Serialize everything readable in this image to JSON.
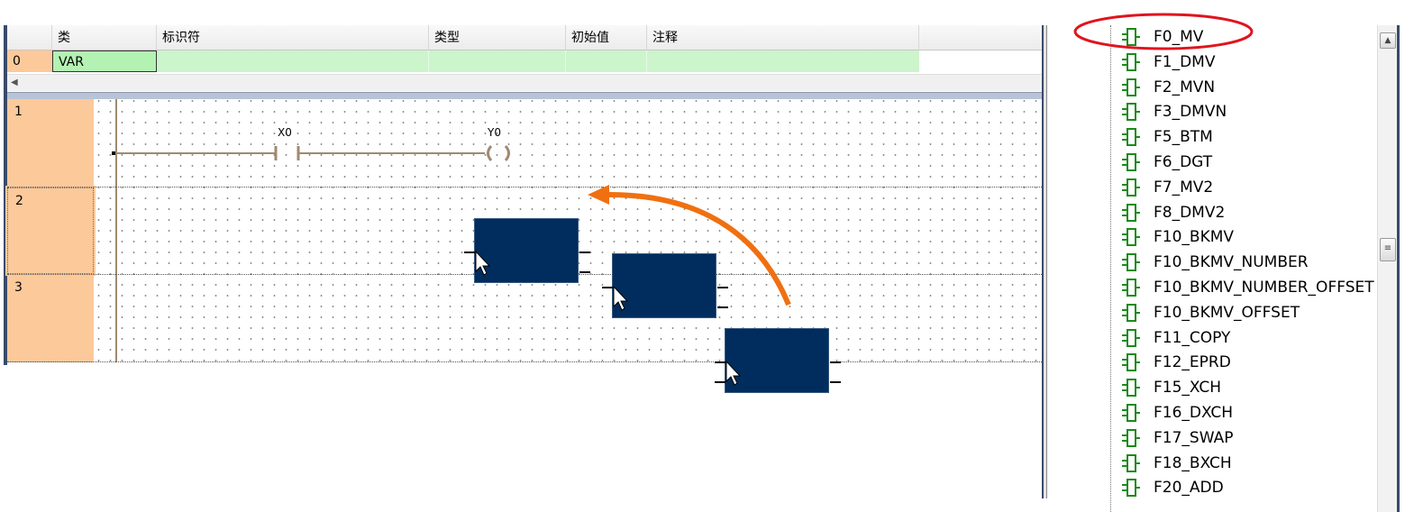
{
  "var_table": {
    "headers": [
      "类",
      "标识符",
      "类型",
      "初始值",
      "注释"
    ],
    "row": {
      "index": "0",
      "class": "VAR"
    },
    "colors": {
      "row_bg": "#ccf5cc",
      "selected_cell": "#b3f2b3"
    }
  },
  "ladder": {
    "rungs": [
      "1",
      "2",
      "3"
    ],
    "contact_label": "X0",
    "coil_label": "Y0",
    "colors": {
      "rung_label_bg": "#fcc99a",
      "wire": "#a08a70",
      "block": "#002d5e"
    }
  },
  "annotations": {
    "arrow_color": "#f07010",
    "highlight_color": "#e0141e"
  },
  "tree": {
    "icon": "function-block-icon",
    "items": [
      "F0_MV",
      "F1_DMV",
      "F2_MVN",
      "F3_DMVN",
      "F5_BTM",
      "F6_DGT",
      "F7_MV2",
      "F8_DMV2",
      "F10_BKMV",
      "F10_BKMV_NUMBER",
      "F10_BKMV_NUMBER_OFFSET",
      "F10_BKMV_OFFSET",
      "F11_COPY",
      "F12_EPRD",
      "F15_XCH",
      "F16_DXCH",
      "F17_SWAP",
      "F18_BXCH",
      "F20_ADD"
    ],
    "highlighted": "F0_MV"
  },
  "scrollbar": {
    "up_icon": "scroll-up-icon",
    "thumb_icon": "scroll-thumb-grip-icon"
  }
}
